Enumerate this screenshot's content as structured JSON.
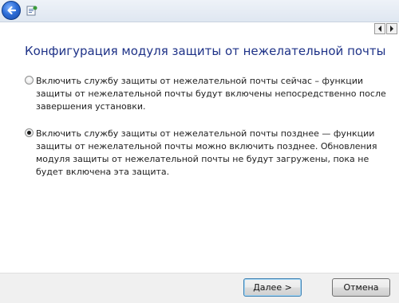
{
  "titlebar": {
    "back_icon": "back-arrow-icon",
    "app_icon": "app-icon"
  },
  "scroll": {
    "left_icon": "scroll-left-icon",
    "right_icon": "scroll-right-icon"
  },
  "page": {
    "title": "Конфигурация модуля защиты от нежелательной почты"
  },
  "options": [
    {
      "selected": false,
      "text": "Включить службу защиты от нежелательной почты сейчас – функции защиты от нежелательной почты будут включены непосредственно после завершения установки."
    },
    {
      "selected": true,
      "text": "Включить службу защиты от нежелательной почты позднее — функции защиты от нежелательной почты можно включить позднее. Обновления модуля защиты от нежелательной почты не будут загружены, пока не будет включена эта защита."
    }
  ],
  "buttons": {
    "next_label": "Далее >",
    "cancel_label": "Отмена"
  },
  "colors": {
    "title": "#1e3287",
    "footer_bg": "#f0f0f0",
    "accent": "#2f6fd8"
  }
}
